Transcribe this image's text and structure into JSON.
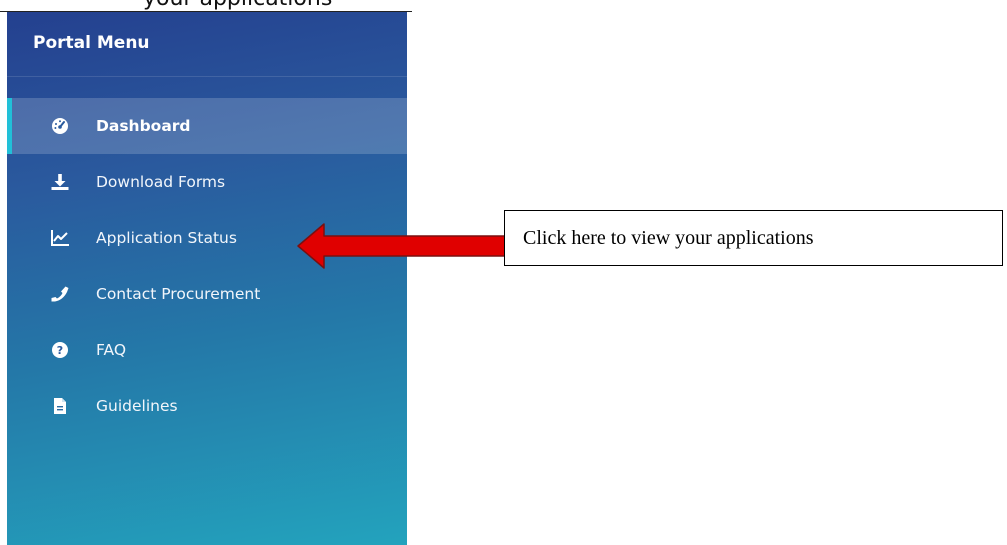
{
  "header_fragment": "your applications",
  "sidebar": {
    "title": "Portal Menu",
    "items": [
      {
        "label": "Dashboard",
        "icon": "dashboard-gauge-icon",
        "active": true
      },
      {
        "label": "Download Forms",
        "icon": "download-icon",
        "active": false
      },
      {
        "label": "Application Status",
        "icon": "line-chart-icon",
        "active": false
      },
      {
        "label": "Contact Procurement",
        "icon": "phone-icon",
        "active": false
      },
      {
        "label": "FAQ",
        "icon": "question-circle-icon",
        "active": false
      },
      {
        "label": "Guidelines",
        "icon": "file-icon",
        "active": false
      }
    ]
  },
  "annotation": {
    "callout_text": "Click here to view your applications",
    "arrow_color": "#e00000"
  },
  "colors": {
    "sidebar_top": "#24408f",
    "sidebar_bottom": "#23a3bd",
    "active_accent": "#21c0d8"
  }
}
